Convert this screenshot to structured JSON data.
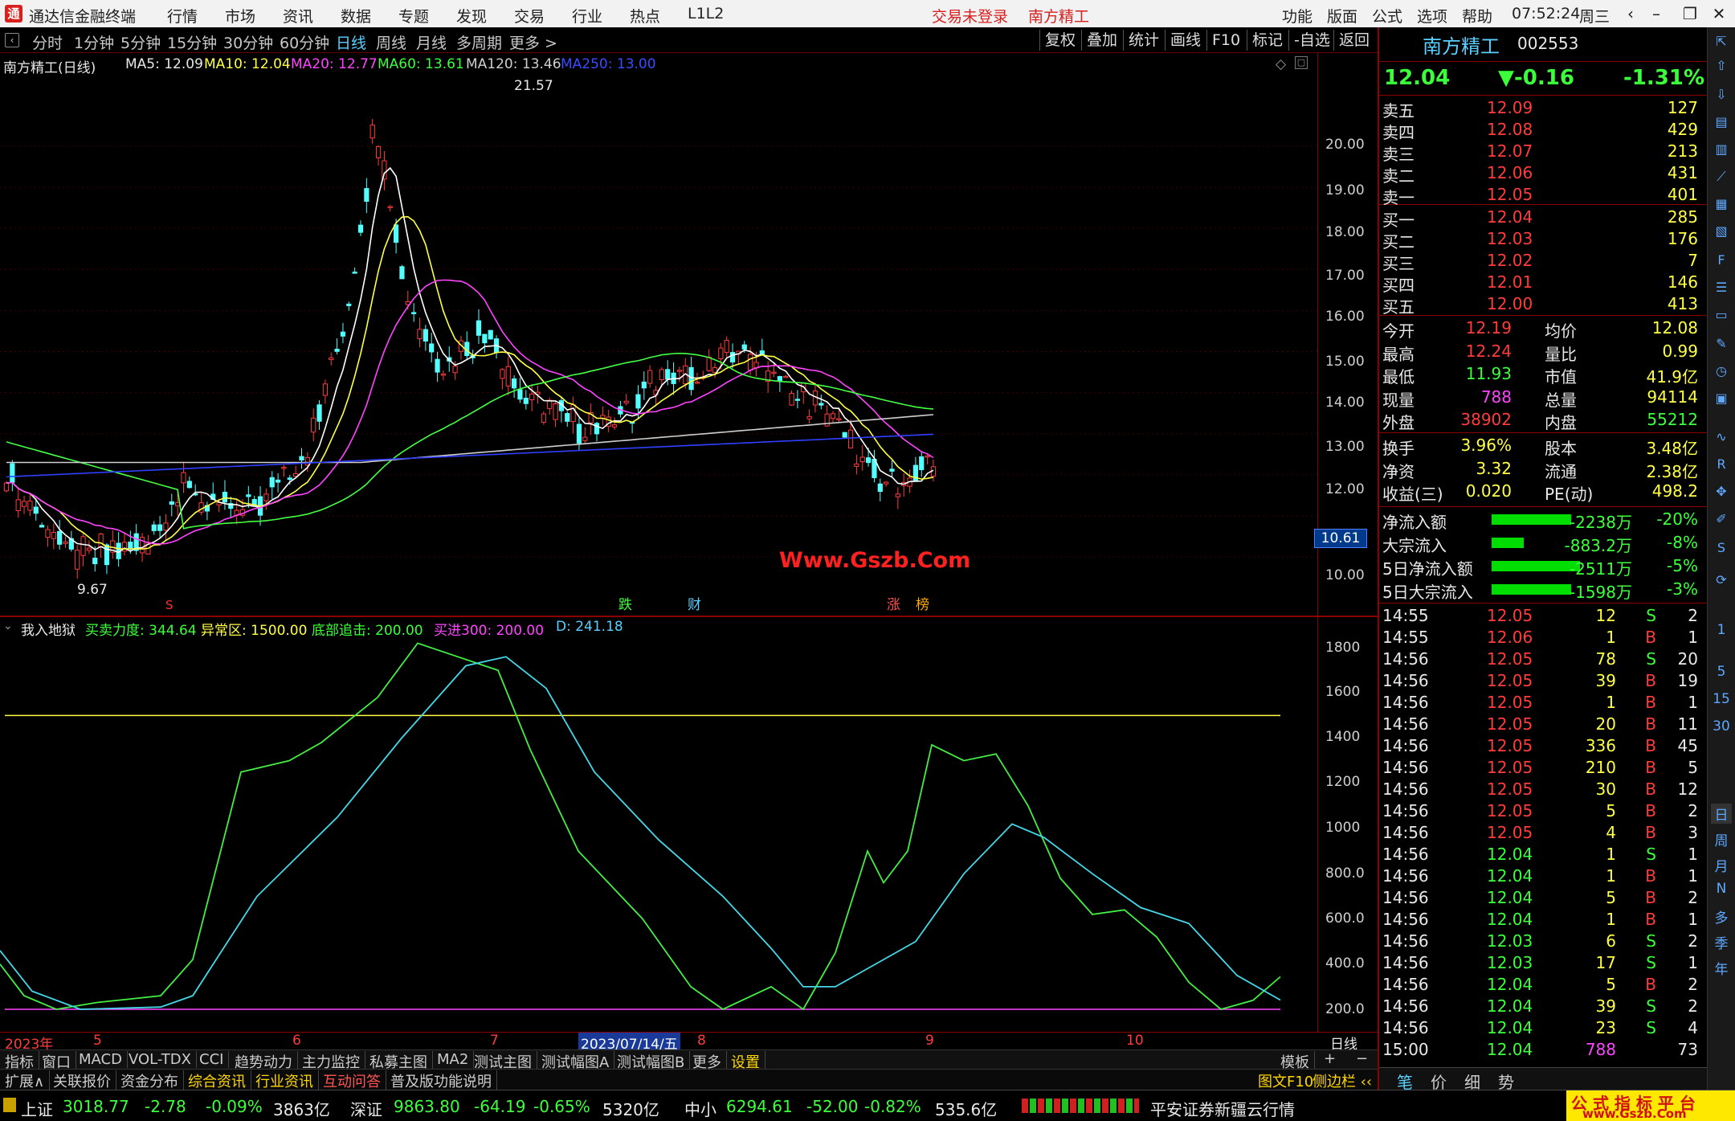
{
  "titlebar": {
    "app": "通达信金融终端",
    "logo": "通",
    "menus": [
      "行情",
      "市场",
      "资讯",
      "数据",
      "专题",
      "发现",
      "交易",
      "行业",
      "热点",
      "L1L2"
    ],
    "trade_status": "交易未登录",
    "stock_name": "南方精工",
    "right_menus": [
      "功能",
      "版面",
      "公式",
      "选项",
      "帮助"
    ],
    "time": "07:52:24",
    "weekday": "周三"
  },
  "periods": [
    "分时",
    "1分钟",
    "5分钟",
    "15分钟",
    "30分钟",
    "60分钟",
    "日线",
    "周线",
    "月线",
    "多周期",
    "更多 >"
  ],
  "period_active": "日线",
  "chart_tools": [
    "复权",
    "叠加",
    "统计",
    "画线",
    "F10",
    "标记",
    "-自选",
    "返回"
  ],
  "kinfo": {
    "name": "南方精工(日线)",
    "ma5": "MA5: 12.09",
    "ma10": "MA10: 12.04",
    "ma20": "MA20: 12.77",
    "ma60": "MA60: 13.61",
    "ma120": "MA120: 13.46",
    "ma250": "MA250: 13.00",
    "high_label": "21.57",
    "low_label": "9.67",
    "price_tag": "10.61",
    "watermark": "Www.Gszb.Com"
  },
  "price_axis": [
    "20.00",
    "19.00",
    "18.00",
    "17.00",
    "16.00",
    "15.00",
    "14.00",
    "13.00",
    "12.00",
    "10.00"
  ],
  "markers": {
    "s": "S",
    "die": "跌",
    "cai": "财",
    "zhang": "涨",
    "bang": "榜"
  },
  "indicator": {
    "name": "我入地狱",
    "l1": "买卖力度: 344.64",
    "l2": "异常区: 1500.00",
    "l3": "底部追击: 200.00",
    "l4": "买进300: 200.00",
    "l5": "D: 241.18"
  },
  "ind_axis": [
    "1800",
    "1600",
    "1400",
    "1200",
    "1000",
    "800.0",
    "600.0",
    "400.0",
    "200.0"
  ],
  "dates": {
    "y": "2023年",
    "m5": "5",
    "m6": "6",
    "m7": "7",
    "sel": "2023/07/14/五",
    "m8": "8",
    "m9": "9",
    "m10": "10",
    "right": "日线"
  },
  "tabs1": [
    "指标",
    "窗口",
    "MACD",
    "VOL-TDX",
    "CCI",
    "趋势动力",
    "主力监控",
    "私募主图",
    "MA2",
    "测试主图",
    "测试幅图A",
    "测试幅图B",
    "更多",
    "设置"
  ],
  "tabs1_right": "模板",
  "tabs2": [
    "扩展∧",
    "关联报价",
    "资金分布",
    "综合资讯",
    "行业资讯",
    "互动问答",
    "普及版功能说明"
  ],
  "tabs2_right": [
    "图文F10",
    "侧边栏 ‹‹"
  ],
  "quote": {
    "name": "南方精工",
    "code": "002553",
    "price": "12.04",
    "change": "▼-0.16",
    "pct": "-1.31%",
    "asks": [
      [
        "卖五",
        "12.09",
        "127"
      ],
      [
        "卖四",
        "12.08",
        "429"
      ],
      [
        "卖三",
        "12.07",
        "213"
      ],
      [
        "卖二",
        "12.06",
        "431"
      ],
      [
        "卖一",
        "12.05",
        "401"
      ]
    ],
    "bids": [
      [
        "买一",
        "12.04",
        "285"
      ],
      [
        "买二",
        "12.03",
        "176"
      ],
      [
        "买三",
        "12.02",
        "7"
      ],
      [
        "买四",
        "12.01",
        "146"
      ],
      [
        "买五",
        "12.00",
        "413"
      ]
    ],
    "stats": [
      [
        "今开",
        "12.19",
        "均价",
        "12.08"
      ],
      [
        "最高",
        "12.24",
        "量比",
        "0.99"
      ],
      [
        "最低",
        "11.93",
        "市值",
        "41.9亿"
      ],
      [
        "现量",
        "788",
        "总量",
        "94114"
      ],
      [
        "外盘",
        "38902",
        "内盘",
        "55212"
      ]
    ],
    "stats2": [
      [
        "换手",
        "3.96%",
        "股本",
        "3.48亿"
      ],
      [
        "净资",
        "3.32",
        "流通",
        "2.38亿"
      ],
      [
        "收益(三)",
        "0.020",
        "PE(动)",
        "498.2"
      ]
    ],
    "flows": [
      [
        "净流入额",
        "-2238万",
        "-20%",
        0.9
      ],
      [
        "大宗流入",
        "-883.2万",
        "-8%",
        0.36
      ],
      [
        "5日净流入额",
        "-2511万",
        "-5%",
        1.0
      ],
      [
        "5日大宗流入",
        "-1598万",
        "-3%",
        0.9
      ]
    ],
    "ticks": [
      [
        "14:55",
        "12.05",
        "12",
        "S",
        "2"
      ],
      [
        "14:55",
        "12.06",
        "1",
        "B",
        "1"
      ],
      [
        "14:56",
        "12.05",
        "78",
        "S",
        "20"
      ],
      [
        "14:56",
        "12.05",
        "39",
        "B",
        "19"
      ],
      [
        "14:56",
        "12.05",
        "1",
        "B",
        "1"
      ],
      [
        "14:56",
        "12.05",
        "20",
        "B",
        "11"
      ],
      [
        "14:56",
        "12.05",
        "336",
        "B",
        "45"
      ],
      [
        "14:56",
        "12.05",
        "210",
        "B",
        "5"
      ],
      [
        "14:56",
        "12.05",
        "30",
        "B",
        "12"
      ],
      [
        "14:56",
        "12.05",
        "5",
        "B",
        "2"
      ],
      [
        "14:56",
        "12.05",
        "4",
        "B",
        "3"
      ],
      [
        "14:56",
        "12.04",
        "1",
        "S",
        "1"
      ],
      [
        "14:56",
        "12.04",
        "1",
        "B",
        "1"
      ],
      [
        "14:56",
        "12.04",
        "5",
        "B",
        "2"
      ],
      [
        "14:56",
        "12.04",
        "1",
        "B",
        "1"
      ],
      [
        "14:56",
        "12.03",
        "6",
        "S",
        "2"
      ],
      [
        "14:56",
        "12.03",
        "17",
        "S",
        "1"
      ],
      [
        "14:56",
        "12.04",
        "5",
        "B",
        "2"
      ],
      [
        "14:56",
        "12.04",
        "39",
        "S",
        "2"
      ],
      [
        "14:56",
        "12.04",
        "23",
        "S",
        "4"
      ],
      [
        "15:00",
        "12.04",
        "788",
        "",
        73
      ]
    ],
    "bottom_tabs": [
      "笔",
      "价",
      "细",
      "势"
    ]
  },
  "status": {
    "sh": "上证",
    "sh_v": "3018.77",
    "sh_c": "-2.78",
    "sh_p": "-0.09%",
    "sh_a": "3863亿",
    "sz": "深证",
    "sz_v": "9863.80",
    "sz_c": "-64.19",
    "sz_p": "-0.65%",
    "sz_a": "5320亿",
    "zx": "中小",
    "zx_v": "6294.61",
    "zx_c": "-52.00",
    "zx_p": "-0.82%",
    "zx_a": "535.6亿",
    "broker": "平安证券新疆云行情",
    "brand": "公 式 指 标 平 台",
    "brand_url": "www.Gszb.Com"
  },
  "rightbar": [
    "日",
    "周",
    "月",
    "N",
    "多",
    "季",
    "年"
  ],
  "rightbar_nums": [
    "1",
    "5",
    "15",
    "30"
  ]
}
